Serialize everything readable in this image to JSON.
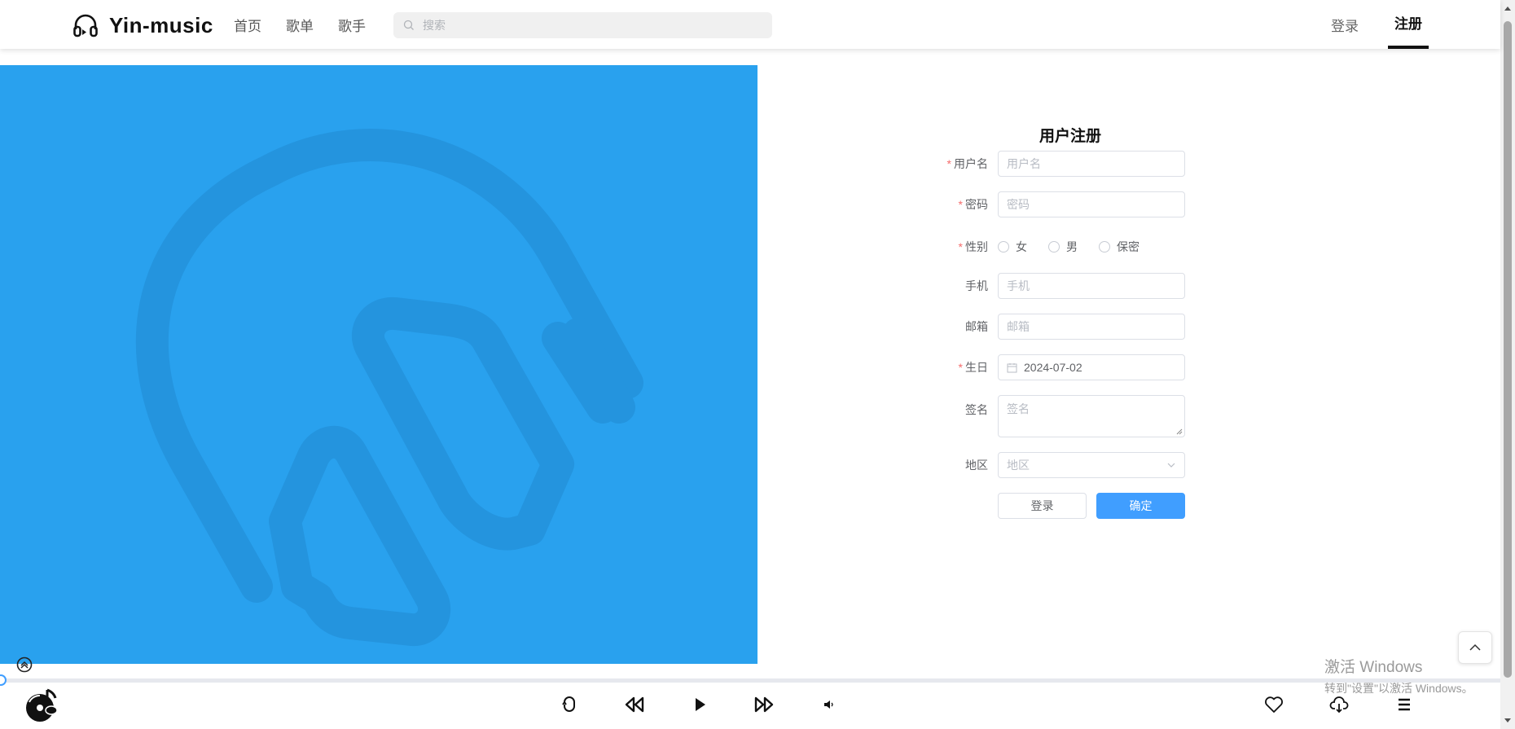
{
  "header": {
    "app_name": "Yin-music",
    "nav": [
      "首页",
      "歌单",
      "歌手"
    ],
    "search_placeholder": "搜索",
    "login_label": "登录",
    "register_label": "注册"
  },
  "form": {
    "title": "用户注册",
    "username": {
      "label": "用户名",
      "placeholder": "用户名",
      "required": true
    },
    "password": {
      "label": "密码",
      "placeholder": "密码",
      "required": true
    },
    "gender": {
      "label": "性别",
      "options": [
        "女",
        "男",
        "保密"
      ],
      "required": true
    },
    "phone": {
      "label": "手机",
      "placeholder": "手机"
    },
    "email": {
      "label": "邮箱",
      "placeholder": "邮箱"
    },
    "birthday": {
      "label": "生日",
      "value": "2024-07-02",
      "required": true
    },
    "signature": {
      "label": "签名",
      "placeholder": "签名"
    },
    "region": {
      "label": "地区",
      "placeholder": "地区"
    },
    "login_button": "登录",
    "confirm_button": "确定",
    "required_mark": "*"
  },
  "player": {
    "progress": 0
  },
  "watermark": {
    "title": "激活 Windows",
    "subtitle": "转到\"设置\"以激活 Windows。"
  },
  "colors": {
    "panel": "#29a1ee",
    "primary": "#409eff",
    "required": "#f56c6c"
  }
}
